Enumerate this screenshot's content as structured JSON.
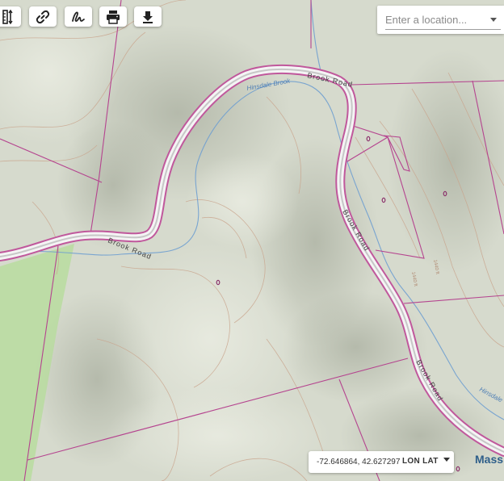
{
  "toolbar": {
    "buttons": [
      {
        "name": "measure",
        "icon": "ruler-icon"
      },
      {
        "name": "link",
        "icon": "link-icon"
      },
      {
        "name": "draw",
        "icon": "signature-icon"
      },
      {
        "name": "print",
        "icon": "print-icon"
      },
      {
        "name": "download",
        "icon": "download-icon"
      }
    ]
  },
  "search": {
    "placeholder": "Enter a location..."
  },
  "map": {
    "road_labels": [
      "Brook Road",
      "Brook Road",
      "Brook Road",
      "Brook Road"
    ],
    "stream_labels": [
      "Hinsdale Brook",
      "Hinsdale"
    ],
    "contour_labels": [
      "1440 ft",
      "1440 ft"
    ],
    "edge_label": "Mass",
    "colors": {
      "terrain": "#d9ddd0",
      "forest_green": "#b8dca0",
      "parcel_line": "#b5448f",
      "road_outline": "#c0589c",
      "road_fill": "#f4f4f4",
      "stream": "#6f9fd0",
      "contour": "#c9a48c"
    }
  },
  "coordinates": {
    "value": "-72.646864, 42.627297",
    "format": "LON LAT"
  }
}
